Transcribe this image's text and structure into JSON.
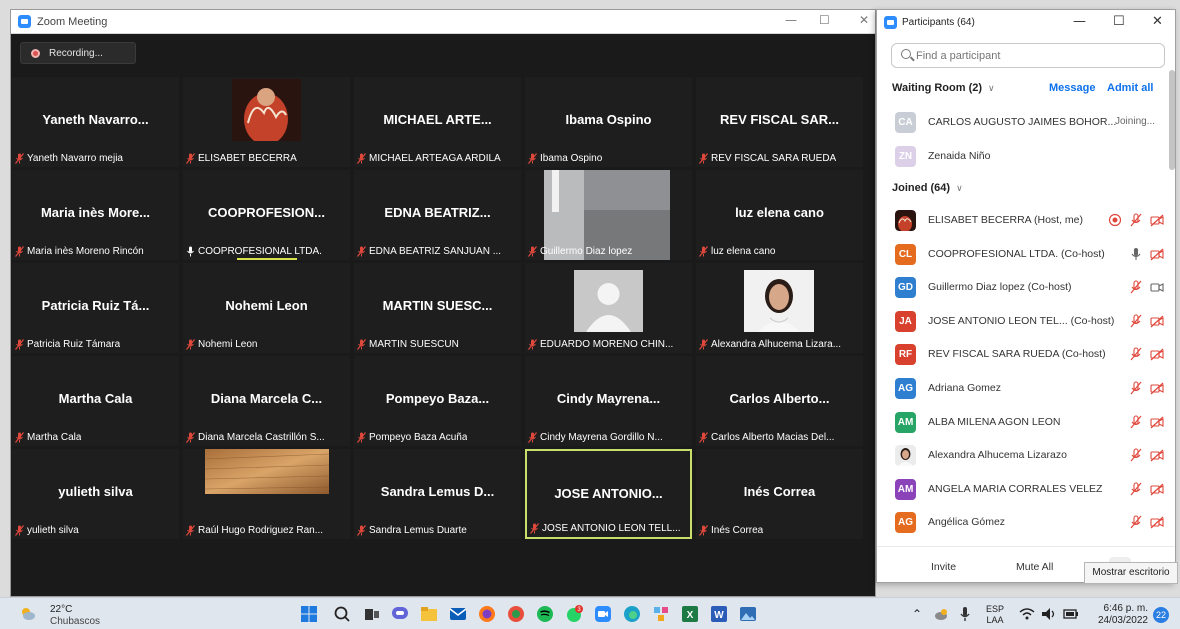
{
  "zoom_window": {
    "title": "Zoom Meeting",
    "recording_label": "Recording..."
  },
  "tiles": [
    {
      "big": "Yaneth Navarro...",
      "label": "Yaneth Navarro mejia",
      "muted": true
    },
    {
      "big": "",
      "label": "ELISABET BECERRA",
      "muted": true,
      "photo": "ely"
    },
    {
      "big": "MICHAEL ARTE...",
      "label": "MICHAEL ARTEAGA ARDILA",
      "muted": true
    },
    {
      "big": "Ibama Ospino",
      "label": "Ibama Ospino",
      "muted": true
    },
    {
      "big": "REV FISCAL SAR...",
      "label": "REV FISCAL SARA RUEDA",
      "muted": true
    },
    {
      "big": "Maria inès More...",
      "label": "Maria inès Moreno Rincón",
      "muted": true
    },
    {
      "big": "COOPROFESION...",
      "label": "COOPROFESIONAL LTDA.",
      "muted": false
    },
    {
      "big": "EDNA BEATRIZ...",
      "label": "EDNA BEATRIZ SANJUAN ...",
      "muted": true
    },
    {
      "big": "",
      "label": "Guillermo Diaz lopez",
      "muted": true,
      "photo": "room"
    },
    {
      "big": "luz elena cano",
      "label": "luz elena cano",
      "muted": true
    },
    {
      "big": "Patricia Ruiz Tá...",
      "label": "Patricia Ruiz Támara",
      "muted": true
    },
    {
      "big": "Nohemi Leon",
      "label": "Nohemi Leon",
      "muted": true
    },
    {
      "big": "MARTIN SUESC...",
      "label": "MARTIN SUESCUN",
      "muted": true
    },
    {
      "big": "",
      "label": "EDUARDO MORENO CHIN...",
      "muted": true,
      "photo": "placeholder"
    },
    {
      "big": "",
      "label": "Alexandra Alhucema Lizara...",
      "muted": true,
      "photo": "woman"
    },
    {
      "big": "Martha Cala",
      "label": "Martha Cala",
      "muted": true
    },
    {
      "big": "Diana Marcela C...",
      "label": "Diana Marcela Castrillón S...",
      "muted": true
    },
    {
      "big": "Pompeyo Baza...",
      "label": "Pompeyo Baza Acuña",
      "muted": true
    },
    {
      "big": "Cindy Mayrena...",
      "label": "Cindy Mayrena Gordillo N...",
      "muted": true
    },
    {
      "big": "Carlos Alberto...",
      "label": "Carlos Alberto Macias Del...",
      "muted": true
    },
    {
      "big": "yulieth silva",
      "label": "yulieth silva",
      "muted": true
    },
    {
      "big": "",
      "label": "Raúl Hugo Rodriguez Ran...",
      "muted": true,
      "photo": "wood"
    },
    {
      "big": "Sandra Lemus D...",
      "label": "Sandra Lemus Duarte",
      "muted": true
    },
    {
      "big": "JOSE ANTONIO...",
      "label": "JOSE ANTONIO LEON TELL...",
      "muted": true,
      "active": true
    },
    {
      "big": "Inés Correa",
      "label": "Inés Correa",
      "muted": true
    }
  ],
  "participants": {
    "title": "Participants (64)",
    "search_placeholder": "Find a participant",
    "waiting_header": "Waiting Room (2)",
    "message_label": "Message",
    "admit_all_label": "Admit all",
    "waiting": [
      {
        "initials": "CA",
        "name": "CARLOS AUGUSTO JAIMES BOHOR...",
        "status": "Joining...",
        "color": "#c9ced6"
      },
      {
        "initials": "ZN",
        "name": "Zenaida Niño",
        "status": "",
        "color": "#dccfe8"
      }
    ],
    "joined_header": "Joined (64)",
    "joined": [
      {
        "initials": "",
        "name": "ELISABET BECERRA (Host, me)",
        "color": "#7b2a1e",
        "icons": [
          "record-icon",
          "mic-muted-icon",
          "video-off-icon"
        ]
      },
      {
        "initials": "CL",
        "name": "COOPROFESIONAL LTDA. (Co-host)",
        "color": "#e56b1f",
        "icons": [
          "mic-icon",
          "video-off-icon"
        ]
      },
      {
        "initials": "GD",
        "name": "Guillermo Diaz lopez (Co-host)",
        "color": "#2f7fd1",
        "icons": [
          "mic-muted-icon",
          "video-icon"
        ]
      },
      {
        "initials": "JA",
        "name": "JOSE ANTONIO LEON TEL...  (Co-host)",
        "color": "#d9412f",
        "icons": [
          "mic-muted-icon",
          "video-off-icon"
        ]
      },
      {
        "initials": "RF",
        "name": "REV FISCAL SARA RUEDA (Co-host)",
        "color": "#d9412f",
        "icons": [
          "mic-muted-icon",
          "video-off-icon"
        ]
      },
      {
        "initials": "AG",
        "name": "Adriana Gomez",
        "color": "#2f7fd1",
        "icons": [
          "mic-muted-icon",
          "video-off-icon"
        ]
      },
      {
        "initials": "AM",
        "name": "ALBA MILENA AGON LEON",
        "color": "#27a567",
        "icons": [
          "mic-muted-icon",
          "video-off-icon"
        ]
      },
      {
        "initials": "",
        "name": "Alexandra Alhucema Lizarazo",
        "color": "#9a9a9a",
        "icons": [
          "mic-muted-icon",
          "video-off-icon"
        ]
      },
      {
        "initials": "AM",
        "name": "ANGELA MARIA CORRALES VELEZ",
        "color": "#8a43b8",
        "icons": [
          "mic-muted-icon",
          "video-off-icon"
        ]
      },
      {
        "initials": "AG",
        "name": "Angélica Gómez",
        "color": "#e56b1f",
        "icons": [
          "mic-muted-icon",
          "video-off-icon"
        ]
      }
    ],
    "invite_label": "Invite",
    "mute_all_label": "Mute All"
  },
  "tooltip": "Mostrar escritorio",
  "taskbar": {
    "temperature": "22°C",
    "weather": "Chubascos",
    "lang_1": "ESP",
    "lang_2": "LAA",
    "time": "6:46 p. m.",
    "date": "24/03/2022",
    "notifications": "22",
    "badge_count": "3"
  },
  "colors": {
    "zoom_blue": "#2d8cff",
    "muted_red": "#e0483c",
    "active_speaker": "#c9df6b"
  }
}
